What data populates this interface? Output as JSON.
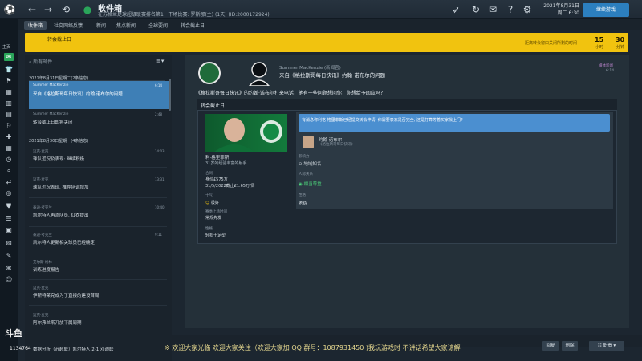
{
  "window": {
    "title": "收件箱",
    "subtitle": "在苏格兰足球超级联赛排名第1 · 下场比赛: 罗斯郡(主) (1天) (ID:2000172924)"
  },
  "status": {
    "date_line1": "2021年8月31日",
    "date_line2": "周二 6:30",
    "continue_label": "继续游戏"
  },
  "rail": {
    "label": "主页"
  },
  "tabs": [
    "收件箱",
    "社交网络反馈",
    "新闻",
    "焦点新闻",
    "全球要闻",
    "转会截止日"
  ],
  "banner": {
    "left_text": "转会截止日",
    "right_text": "距离转会窗口关闭所剩的时间",
    "n1": "15",
    "u1": "小时",
    "n2": "30",
    "u2": "分钟"
  },
  "list": {
    "search_placeholder": "所有邮件",
    "groups": [
      {
        "label": "2021年8月31日星期二(2条信息)"
      },
      {
        "label": "2021年8月30日星期一(4条信息)"
      }
    ],
    "items": [
      {
        "sender": "Summer MacKenzie",
        "title": "来自《格拉斯哥每日快讯》约翰·诺布尔的问题",
        "time": "6:14"
      },
      {
        "sender": "Summer MacKenzie",
        "title": "转会截止日即将关闭",
        "time": "2:48"
      },
      {
        "sender": "迈克·麦克",
        "title": "球队近况及表现: 继续积极",
        "time": "14:03"
      },
      {
        "sender": "迈克·麦克",
        "title": "球队近况表现, 推荐培训增加",
        "time": "13:31"
      },
      {
        "sender": "泰迪·考克兰",
        "title": "凯尔特人再添队员, 红衣提出",
        "time": "10:40"
      },
      {
        "sender": "泰迪·考克兰",
        "title": "凯尔特人更新相关球员已经确定",
        "time": "9:11"
      },
      {
        "sender": "艾尔斯·格林",
        "title": "训练进度报告",
        "time": ""
      },
      {
        "sender": "迈克·麦克",
        "title": "伊斯特莱克成为了直接的建设首周",
        "time": ""
      },
      {
        "sender": "迈克·麦克",
        "title": "阿尔弗兰斯开放下属周期",
        "time": ""
      },
      {
        "sender": "迈克·麦克",
        "title": "数据分析（苏超联）凯尔特人 2-1 邓迪联",
        "time": ""
      }
    ]
  },
  "message": {
    "sender": "Summer MacKenzie (新闻官)",
    "subject": "来自《格拉斯哥每日快讯》约翰·诺布尔的问题",
    "tag": "媒体新闻",
    "date": "6:14",
    "body": "《格拉斯哥每日快讯》的约翰·诺布尔打来电话，他有一些问题想问你，你想给予回应吗？",
    "card_title": "转会截止日"
  },
  "player": {
    "name": "利·格里菲斯",
    "desc": "31岁的经验丰富的射手",
    "contract_label": "合同",
    "contract_value": "身价£575万",
    "contract_date": "31/5/2022截止£1.65万/周",
    "morale_label": "士气",
    "morale_value": "极好",
    "apps_label": "赛季上场时间",
    "apps_value": "常规先发",
    "personality_label": "性格",
    "personality_value": "轻松十足型"
  },
  "reporter": {
    "question": "有消息称利格·格里菲斯已经提交转会申请, 你需要表态是否完全, 还是打算等着买家找上门?",
    "name": "约翰·诺布尔",
    "outlet": "《格拉斯哥每日快讯》",
    "influence_label": "影响力",
    "influence_value": "地域知名",
    "attitude_label": "人际关系",
    "attitude_value": "相当尊重",
    "personality_label": "性格",
    "personality_value": "老练"
  },
  "bottom": {
    "btn1": "回复",
    "btn2": "删除",
    "btn3": "职责"
  },
  "overlay": {
    "sponsor_text": "※ 欢迎大家光临  欢迎大家关注（欢迎大家加 QQ 群号：1087931450 )我玩游戏时 不讲话希望大家谅解",
    "viewers": "1134764",
    "watermark": "斗鱼"
  }
}
